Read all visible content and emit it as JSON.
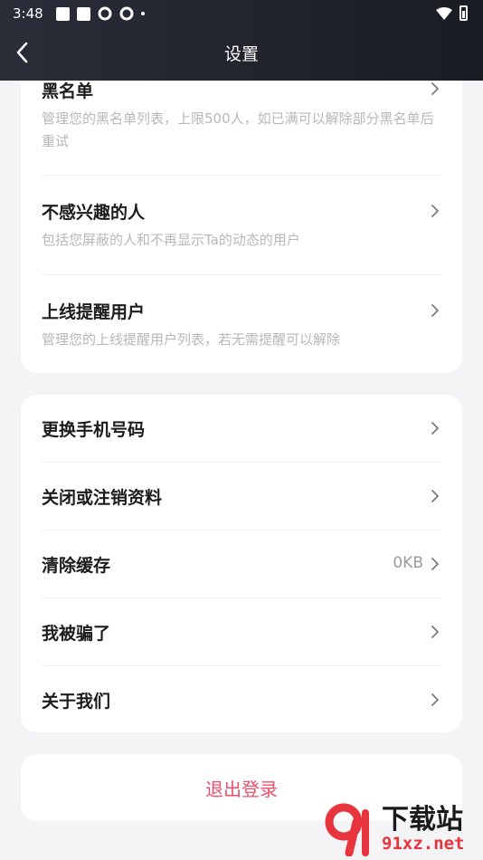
{
  "status_bar": {
    "time": "3:48"
  },
  "header": {
    "title": "设置"
  },
  "privacy_card": {
    "items": [
      {
        "title": "黑名单",
        "desc": "管理您的黑名单列表，上限500人，如已满可以解除部分黑名单后重试"
      },
      {
        "title": "不感兴趣的人",
        "desc": "包括您屏蔽的人和不再显示Ta的动态的用户"
      },
      {
        "title": "上线提醒用户",
        "desc": "管理您的上线提醒用户列表，若无需提醒可以解除"
      }
    ]
  },
  "account_card": {
    "items": [
      {
        "title": "更换手机号码"
      },
      {
        "title": "关闭或注销资料"
      },
      {
        "title": "清除缓存",
        "value": "0KB"
      },
      {
        "title": "我被骗了"
      },
      {
        "title": "关于我们"
      }
    ]
  },
  "logout": {
    "label": "退出登录"
  },
  "watermark": {
    "brand": "下载站",
    "domain": "91xz.net"
  },
  "colors": {
    "accent": "#ef4f6b",
    "header_bg": "#22252e",
    "page_bg": "#f4f4f6"
  }
}
